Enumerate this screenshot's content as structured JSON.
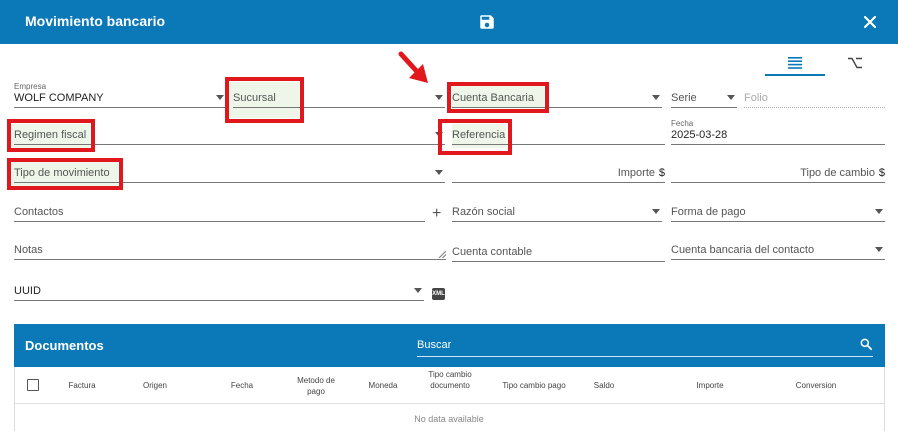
{
  "header": {
    "title": "Movimiento bancario"
  },
  "form": {
    "empresa_label": "Empresa",
    "empresa_value": "WOLF COMPANY",
    "sucursal_placeholder": "Sucursal",
    "cuenta_bancaria_placeholder": "Cuenta Bancaria",
    "serie_placeholder": "Serie",
    "folio_placeholder": "Folio",
    "regimen_fiscal_placeholder": "Regimen fiscal",
    "referencia_placeholder": "Referencia",
    "fecha_label": "Fecha",
    "fecha_value": "2025-03-28",
    "tipo_movimiento_placeholder": "Tipo de movimiento",
    "importe_placeholder": "Importe",
    "currency_symbol": "$",
    "tipo_cambio_placeholder": "Tipo de cambio",
    "contactos_placeholder": "Contactos",
    "plus_symbol": "+",
    "razon_social_placeholder": "Razón social",
    "forma_pago_placeholder": "Forma de pago",
    "notas_placeholder": "Notas",
    "cuenta_contable_placeholder": "Cuenta contable",
    "cuenta_bancaria_contacto_placeholder": "Cuenta bancaria del contacto",
    "uuid_placeholder": "UUID",
    "xml_icon_text": "XML"
  },
  "documents": {
    "title": "Documentos",
    "search_placeholder": "Buscar",
    "columns": [
      "Factura",
      "Origen",
      "Fecha",
      "Metodo de pago",
      "Moneda",
      "Tipo cambio documento",
      "Tipo cambio pago",
      "Saldo",
      "Importe",
      "Conversion"
    ],
    "empty_text": "No data available"
  },
  "colors": {
    "primary": "#0b78b8",
    "highlight_border": "#e1171e",
    "highlight_fill": "#eef6e9"
  }
}
